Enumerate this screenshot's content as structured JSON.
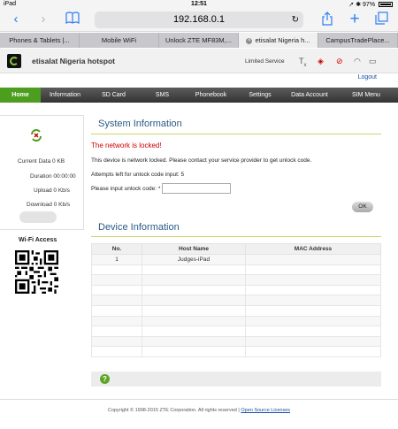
{
  "statusbar": {
    "device": "iPad",
    "time": "12:51",
    "battery": "97%"
  },
  "browser": {
    "url": "192.168.0.1",
    "tabs": [
      {
        "label": "Phones & Tablets |...",
        "active": false
      },
      {
        "label": "Mobile WiFi",
        "active": false
      },
      {
        "label": "Unlock ZTE MF83M,...",
        "active": false
      },
      {
        "label": "etisalat Nigeria h...",
        "active": true
      },
      {
        "label": "CampusTradePlace...",
        "active": false
      }
    ]
  },
  "header": {
    "title": "etisalat Nigeria hotspot",
    "service_status": "Limited Service",
    "logout": "Logout"
  },
  "nav": [
    "Home",
    "Information",
    "SD Card",
    "SMS",
    "Phonebook",
    "Settings",
    "Data Account",
    "SIM Menu"
  ],
  "left_panel": {
    "current_data": "Current Data 0 KB",
    "duration": "Duration 00:00:00",
    "upload": "Upload 0 Kb/s",
    "download": "Download 0 Kb/s",
    "wifi_access": "Wi-Fi Access"
  },
  "system_info": {
    "title": "System Information",
    "locked": "The network is locked!",
    "message": "This device is network locked. Please contact your service provider to get unlock code.",
    "attempts": "Attempts left for unlock code input: 5",
    "input_label": "Please input unlock code: *",
    "ok": "OK"
  },
  "device_info": {
    "title": "Device Information",
    "columns": [
      "No.",
      "Host Name",
      "MAC Address"
    ],
    "rows": [
      [
        "1",
        "Judges-iPad",
        ""
      ]
    ]
  },
  "footer": {
    "copyright": "Copyright © 1998-2015 ZTE Corporation. All rights reserved",
    "separator": "|",
    "link": "Open Source Licenses"
  }
}
